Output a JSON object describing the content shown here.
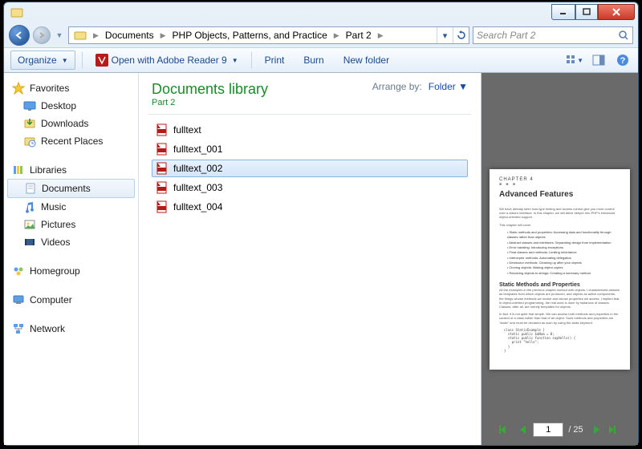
{
  "window": {
    "title": ""
  },
  "breadcrumbs": [
    "Documents",
    "PHP Objects, Patterns, and Practice",
    "Part 2"
  ],
  "search": {
    "placeholder": "Search Part 2"
  },
  "toolbar": {
    "organize": "Organize",
    "reader": "Open with Adobe Reader 9",
    "print": "Print",
    "burn": "Burn",
    "newfolder": "New folder"
  },
  "sidebar": {
    "favorites": {
      "label": "Favorites",
      "items": [
        "Desktop",
        "Downloads",
        "Recent Places"
      ]
    },
    "libraries": {
      "label": "Libraries",
      "items": [
        "Documents",
        "Music",
        "Pictures",
        "Videos"
      ],
      "selected": 0
    },
    "homegroup": "Homegroup",
    "computer": "Computer",
    "network": "Network"
  },
  "library": {
    "title": "Documents library",
    "subtitle": "Part 2",
    "arrange_label": "Arrange by:",
    "arrange_value": "Folder"
  },
  "files": [
    {
      "name": "fulltext",
      "selected": false
    },
    {
      "name": "fulltext_001",
      "selected": false
    },
    {
      "name": "fulltext_002",
      "selected": true
    },
    {
      "name": "fulltext_003",
      "selected": false
    },
    {
      "name": "fulltext_004",
      "selected": false
    }
  ],
  "preview": {
    "chapter": "CHAPTER 4",
    "title": "Advanced Features",
    "section": "Static Methods and Properties",
    "page_current": "1",
    "page_total": "/ 25"
  }
}
